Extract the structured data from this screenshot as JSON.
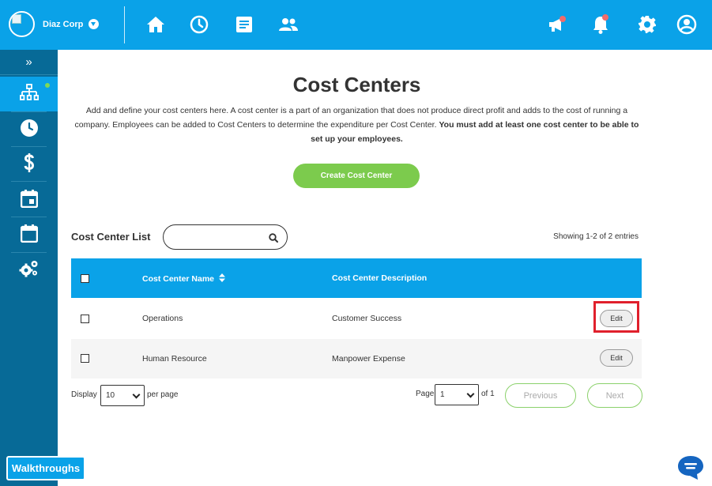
{
  "topbar": {
    "company_name": "Diaz Corp",
    "icons": [
      "home-icon",
      "clock-icon",
      "document-icon",
      "users-icon",
      "megaphone-icon",
      "bell-icon",
      "gear-icon",
      "user-circle-icon"
    ]
  },
  "sidebar": {
    "expand_label": "»",
    "items": [
      "org-chart-icon",
      "clock-icon",
      "dollar-icon",
      "calendar-event-icon",
      "calendar-icon",
      "gears-icon"
    ],
    "walkthroughs_label": "Walkthroughs"
  },
  "main": {
    "title": "Cost Centers",
    "intro_text": "Add and define your cost centers here. A cost center is a part of an organization that does not produce direct profit and adds to the cost of running a company. Employees can be added to Cost Centers to determine the expenditure per Cost Center. ",
    "intro_bold": "You must add at least one cost center to be able to set up your employees.",
    "create_button": "Create Cost Center",
    "list_title": "Cost Center List",
    "search_placeholder": "",
    "showing": "Showing 1-2 of 2 entries"
  },
  "table": {
    "columns": [
      "Cost Center Name",
      "Cost Center Description"
    ],
    "rows": [
      {
        "name": "Operations",
        "description": "Customer Success",
        "action": "Edit"
      },
      {
        "name": "Human Resource",
        "description": "Manpower Expense",
        "action": "Edit"
      }
    ]
  },
  "pagination": {
    "display_label": "Display",
    "per_page_value": "10",
    "per_page_label": "per page",
    "page_label": "Page",
    "page_value": "1",
    "of_label": "of 1",
    "previous": "Previous",
    "next": "Next"
  },
  "colors": {
    "primary": "#0aa2e8",
    "sidebar": "#076a97",
    "accent_green": "#7ccb4d",
    "highlight_red": "#e0202c"
  }
}
